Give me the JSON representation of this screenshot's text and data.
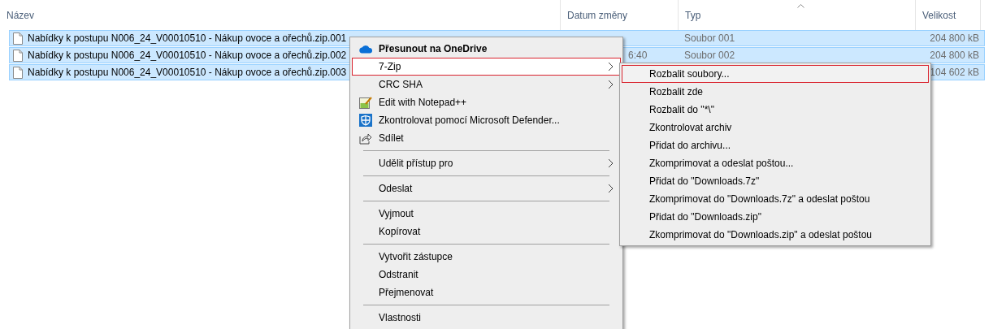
{
  "columns": [
    {
      "label": "Název",
      "sorted": false
    },
    {
      "label": "Datum změny",
      "sorted": false
    },
    {
      "label": "Typ",
      "sorted": true
    },
    {
      "label": "Velikost",
      "sorted": false
    }
  ],
  "files": [
    {
      "name": "Nabídky k postupu N006_24_V00010510 - Nákup ovoce a ořechů.zip.001",
      "type": "Soubor 001",
      "size": "204 800 kB",
      "selected": true
    },
    {
      "name": "Nabídky k postupu N006_24_V00010510 - Nákup ovoce a ořechů.zip.002",
      "date": "6:40",
      "type": "Soubor 002",
      "size": "204 800 kB",
      "selected": true
    },
    {
      "name": "Nabídky k postupu N006_24_V00010510 - Nákup ovoce a ořechů.zip.003",
      "size": "104 602 kB",
      "selected": true
    }
  ],
  "context_menu": [
    {
      "kind": "cloud",
      "label": "Přesunout na OneDrive",
      "bold": true,
      "selected": false
    },
    {
      "kind": "submenu",
      "label": "7-Zip",
      "selected": true
    },
    {
      "kind": "submenu",
      "label": "CRC SHA",
      "selected": false
    },
    {
      "kind": "notepad",
      "label": "Edit with Notepad++",
      "selected": false
    },
    {
      "kind": "shield",
      "label": "Zkontrolovat pomocí Microsoft Defender...",
      "selected": false
    },
    {
      "kind": "share",
      "label": "Sdílet",
      "selected": false
    },
    {
      "kind": "separator"
    },
    {
      "kind": "submenu",
      "label": "Udělit přístup pro",
      "selected": false
    },
    {
      "kind": "separator"
    },
    {
      "kind": "submenu",
      "label": "Odeslat",
      "selected": false
    },
    {
      "kind": "separator"
    },
    {
      "kind": "item",
      "label": "Vyjmout",
      "selected": false
    },
    {
      "kind": "item",
      "label": "Kopírovat",
      "selected": false
    },
    {
      "kind": "separator"
    },
    {
      "kind": "item",
      "label": "Vytvořit zástupce",
      "selected": false
    },
    {
      "kind": "item",
      "label": "Odstranit",
      "selected": false
    },
    {
      "kind": "item",
      "label": "Přejmenovat",
      "selected": false
    },
    {
      "kind": "separator"
    },
    {
      "kind": "item",
      "label": "Vlastnosti",
      "selected": false
    }
  ],
  "submenu": [
    {
      "label": "Rozbalit soubory...",
      "selected": true
    },
    {
      "label": "Rozbalit zde",
      "selected": false
    },
    {
      "label": "Rozbalit do \"*\\\"",
      "selected": false
    },
    {
      "label": "Zkontrolovat archiv",
      "selected": false
    },
    {
      "label": "Přidat do archivu...",
      "selected": false
    },
    {
      "label": "Zkomprimovat a odeslat poštou...",
      "selected": false
    },
    {
      "label": "Přidat do \"Downloads.7z\"",
      "selected": false
    },
    {
      "label": "Zkomprimovat do \"Downloads.7z\" a odeslat poštou",
      "selected": false
    },
    {
      "label": "Přidat do \"Downloads.zip\"",
      "selected": false
    },
    {
      "label": "Zkomprimovat do \"Downloads.zip\" a odeslat poštou",
      "selected": false
    }
  ]
}
